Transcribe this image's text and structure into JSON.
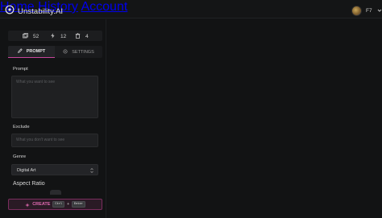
{
  "app": {
    "name": "Unstability.AI"
  },
  "nav": {
    "home": "Home",
    "history": "History",
    "account": "Account"
  },
  "user": {
    "name": "F7"
  },
  "stats": {
    "images": "52",
    "credits": "12",
    "queue": "4"
  },
  "tabs": {
    "prompt": "PROMPT",
    "settings": "SETTINGS"
  },
  "form": {
    "prompt_label": "Prompt",
    "prompt_placeholder": "What you want to see",
    "exclude_label": "Exclude",
    "exclude_placeholder": "What you don't want to see",
    "genre_label": "Genre",
    "genre_value": "Digital Art",
    "aspect_label": "Aspect Ratio"
  },
  "create": {
    "label": "CREATE",
    "key1": "Ctrl",
    "plus": "+",
    "key2": "Enter"
  },
  "colors": {
    "accent": "#c7469a",
    "background": "#121314",
    "panel": "#1f2022"
  }
}
